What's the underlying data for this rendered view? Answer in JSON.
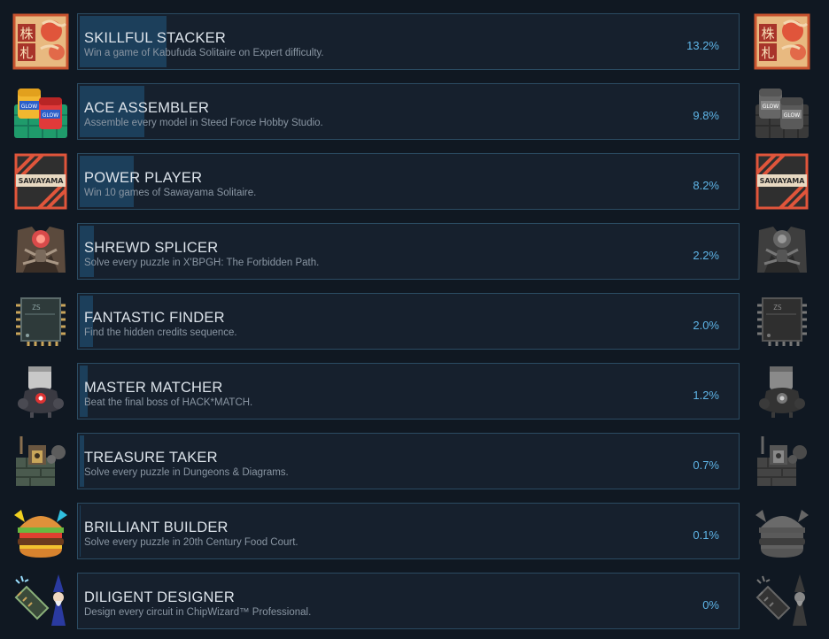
{
  "colors": {
    "background": "#101822",
    "card_background": "#16202d",
    "card_border": "#2b4b62",
    "progress_fill": "#1c3f5b",
    "title_text": "#dce3ea",
    "description_text": "#8a96a3",
    "percent_text": "#5eb4e6"
  },
  "achievements": [
    {
      "title": "SKILLFUL STACKER",
      "description": "Win a game of Kabufuda Solitaire on Expert difficulty.",
      "percent_label": "13.2%",
      "percent": 13.2,
      "icon": "kabufuda-card-icon",
      "icon_text": [
        "株",
        "札"
      ],
      "right_icon_grayscale": false
    },
    {
      "title": "ACE ASSEMBLER",
      "description": "Assemble every model in Steed Force Hobby Studio.",
      "percent_label": "9.8%",
      "percent": 9.8,
      "icon": "paint-pots-icon",
      "icon_text": [
        "GLOW",
        "GLOW"
      ],
      "right_icon_grayscale": true
    },
    {
      "title": "POWER PLAYER",
      "description": "Win 10 games of Sawayama Solitaire.",
      "percent_label": "8.2%",
      "percent": 8.2,
      "icon": "sawayama-card-icon",
      "icon_text": [
        "SAWAYAMA"
      ],
      "right_icon_grayscale": false
    },
    {
      "title": "SHREWD SPLICER",
      "description": "Solve every puzzle in X'BPGH: The Forbidden Path.",
      "percent_label": "2.2%",
      "percent": 2.2,
      "icon": "bug-creature-icon",
      "icon_text": [],
      "right_icon_grayscale": true
    },
    {
      "title": "FANTASTIC FINDER",
      "description": "Find the hidden credits sequence.",
      "percent_label": "2.0%",
      "percent": 2.0,
      "icon": "microchip-icon",
      "icon_text": [
        "ZS"
      ],
      "right_icon_grayscale": true
    },
    {
      "title": "MASTER MATCHER",
      "description": "Beat the final boss of HACK*MATCH.",
      "percent_label": "1.2%",
      "percent": 1.2,
      "icon": "robot-boss-icon",
      "icon_text": [],
      "right_icon_grayscale": true
    },
    {
      "title": "TREASURE TAKER",
      "description": "Solve every puzzle in Dungeons & Diagrams.",
      "percent_label": "0.7%",
      "percent": 0.7,
      "icon": "dungeon-icon",
      "icon_text": [],
      "right_icon_grayscale": true
    },
    {
      "title": "BRILLIANT BUILDER",
      "description": "Solve every puzzle in 20th Century Food Court.",
      "percent_label": "0.1%",
      "percent": 0.1,
      "icon": "burger-icon",
      "icon_text": [],
      "right_icon_grayscale": true
    },
    {
      "title": "DILIGENT DESIGNER",
      "description": "Design every circuit in ChipWizard™ Professional.",
      "percent_label": "0%",
      "percent": 0,
      "icon": "chip-wizard-icon",
      "icon_text": [],
      "right_icon_grayscale": true
    }
  ]
}
